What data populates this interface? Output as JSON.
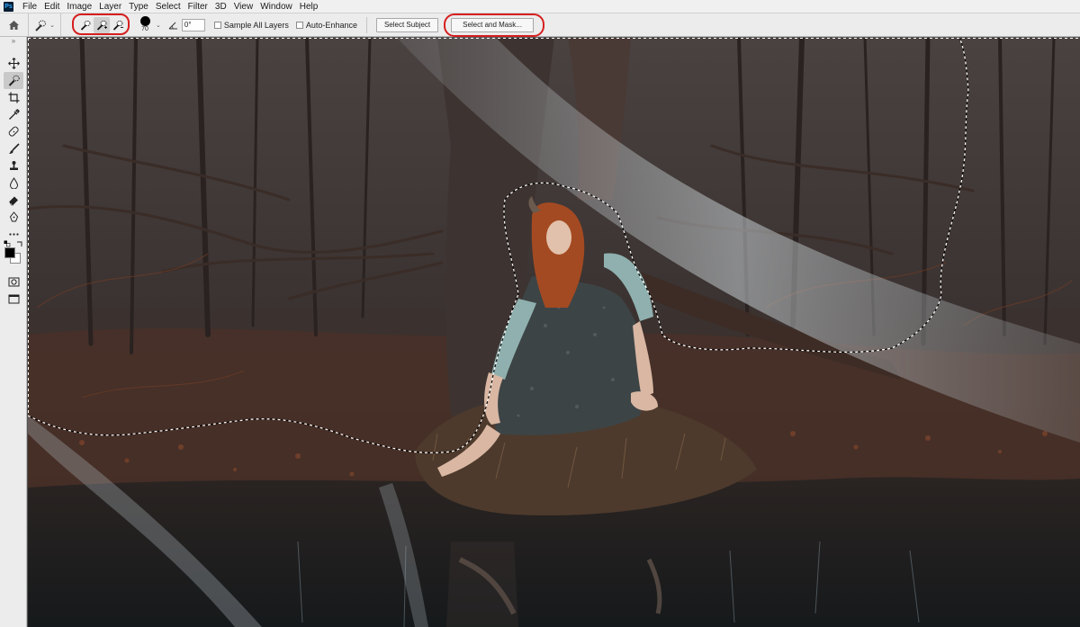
{
  "app": {
    "logo": "Ps"
  },
  "menubar": {
    "items": [
      "File",
      "Edit",
      "Image",
      "Layer",
      "Type",
      "Select",
      "Filter",
      "3D",
      "View",
      "Window",
      "Help"
    ]
  },
  "options": {
    "brush_size": "70",
    "angle": "0°",
    "sample_all_layers_label": "Sample All Layers",
    "auto_enhance_label": "Auto-Enhance",
    "select_subject_label": "Select Subject",
    "select_and_mask_label": "Select and Mask..."
  },
  "toolbar": {
    "tools": [
      "move-icon",
      "quick-selection-icon",
      "crop-icon",
      "eyedropper-icon",
      "healing-brush-icon",
      "brush-icon",
      "clone-stamp-icon",
      "blur-icon",
      "eraser-icon",
      "pen-icon",
      "more-tools-icon"
    ]
  },
  "colors": {
    "annotation_ring": "#d61f1f",
    "foreground": "#000000",
    "background": "#ffffff"
  }
}
